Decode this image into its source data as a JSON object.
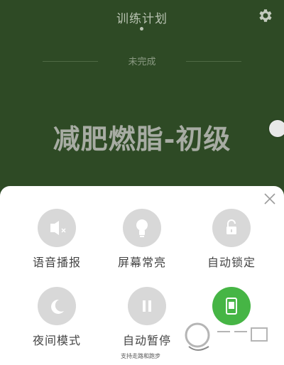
{
  "header": {
    "title": "训练计划",
    "settings_icon": "gear-icon"
  },
  "plan": {
    "status": "未完成",
    "name": "减肥燃脂-初级"
  },
  "sheet": {
    "close_icon": "close-icon",
    "items": [
      {
        "label": "语音播报",
        "icon": "voice-icon",
        "active": false
      },
      {
        "label": "屏幕常亮",
        "icon": "bulb-icon",
        "active": false
      },
      {
        "label": "自动锁定",
        "icon": "lock-icon",
        "active": false
      },
      {
        "label": "夜间模式",
        "icon": "moon-icon",
        "active": false
      },
      {
        "label": "自动暂停",
        "icon": "pause-icon",
        "active": false
      },
      {
        "label": "",
        "icon": "phone-icon",
        "active": true
      }
    ]
  },
  "watermark": {
    "text": "支持走路和跑步"
  },
  "colors": {
    "background": "#2e4a25",
    "active": "#46b545",
    "inactive": "#d8d8d8"
  }
}
